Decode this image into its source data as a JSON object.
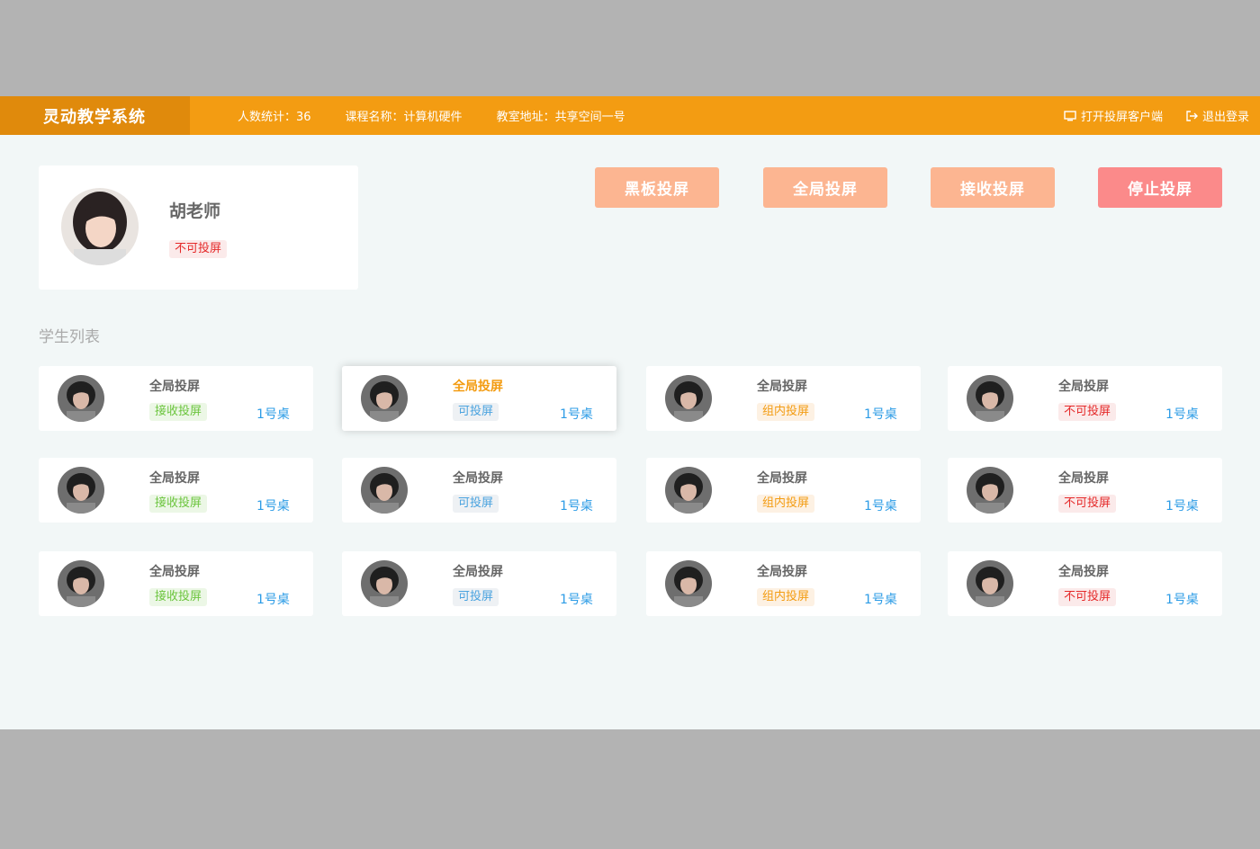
{
  "header": {
    "brand": "灵动教学系统",
    "count_label": "人数统计：36",
    "course_label": "课程名称：计算机硬件",
    "room_label": "教室地址：共享空间一号",
    "open_client": "打开投屏客户端",
    "logout": "退出登录"
  },
  "teacher": {
    "name": "胡老师",
    "status": "不可投屏"
  },
  "actions": {
    "blackboard": "黑板投屏",
    "global": "全局投屏",
    "receive": "接收投屏",
    "stop": "停止投屏"
  },
  "section_title": "学生列表",
  "students": [
    {
      "title": "全局投屏",
      "status": "接收投屏",
      "desk": "1号桌"
    },
    {
      "title": "全局投屏",
      "status": "可投屏",
      "desk": "1号桌"
    },
    {
      "title": "全局投屏",
      "status": "组内投屏",
      "desk": "1号桌"
    },
    {
      "title": "全局投屏",
      "status": "不可投屏",
      "desk": "1号桌"
    },
    {
      "title": "全局投屏",
      "status": "接收投屏",
      "desk": "1号桌"
    },
    {
      "title": "全局投屏",
      "status": "可投屏",
      "desk": "1号桌"
    },
    {
      "title": "全局投屏",
      "status": "组内投屏",
      "desk": "1号桌"
    },
    {
      "title": "全局投屏",
      "status": "不可投屏",
      "desk": "1号桌"
    },
    {
      "title": "全局投屏",
      "status": "接收投屏",
      "desk": "1号桌"
    },
    {
      "title": "全局投屏",
      "status": "可投屏",
      "desk": "1号桌"
    },
    {
      "title": "全局投屏",
      "status": "组内投屏",
      "desk": "1号桌"
    },
    {
      "title": "全局投屏",
      "status": "不可投屏",
      "desk": "1号桌"
    }
  ],
  "colors": {
    "header": "#f39c12",
    "brand_bg": "#e08a0c",
    "button_orange": "#fcb591",
    "button_red": "#fb8a8a",
    "desk_blue": "#2d9ce6"
  }
}
